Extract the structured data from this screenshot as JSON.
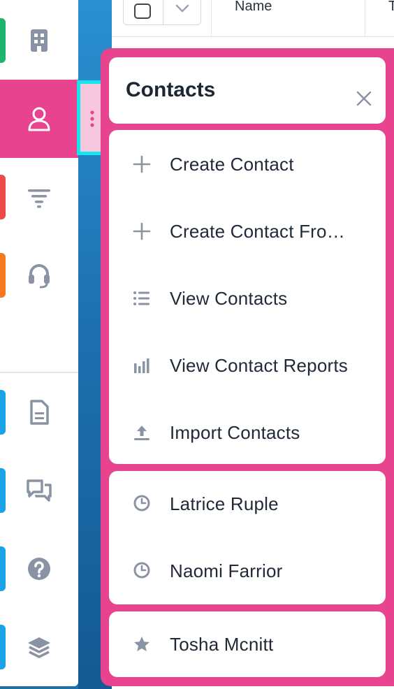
{
  "table": {
    "columns": [
      "Name",
      "T"
    ]
  },
  "sidebar": {
    "items": [
      {
        "name": "buildings",
        "icon": "building-icon",
        "accent": "#1fb36b"
      },
      {
        "name": "contacts",
        "icon": "person-icon",
        "accent": "#e8438f",
        "active": true
      },
      {
        "name": "pipeline",
        "icon": "filter-icon",
        "accent": "#ef4a4a"
      },
      {
        "name": "support",
        "icon": "headset-icon",
        "accent": "#f47a1f"
      },
      {
        "name": "documents",
        "icon": "document-icon",
        "accent": "#1aa3e8"
      },
      {
        "name": "chat",
        "icon": "chat-icon",
        "accent": "#1aa3e8"
      },
      {
        "name": "help",
        "icon": "help-icon",
        "accent": "#1aa3e8"
      },
      {
        "name": "layers",
        "icon": "layers-icon",
        "accent": "#1aa3e8"
      }
    ]
  },
  "flyout": {
    "title": "Contacts",
    "actions": [
      {
        "label": "Create Contact",
        "icon": "plus-icon"
      },
      {
        "label": "Create Contact Fro…",
        "icon": "plus-icon"
      },
      {
        "label": "View Contacts",
        "icon": "list-icon"
      },
      {
        "label": "View Contact Reports",
        "icon": "bar-chart-icon"
      },
      {
        "label": "Import Contacts",
        "icon": "upload-icon"
      }
    ],
    "recent": [
      {
        "label": "Latrice Ruple",
        "icon": "clock-icon"
      },
      {
        "label": "Naomi Farrior",
        "icon": "clock-icon"
      }
    ],
    "favorites": [
      {
        "label": "Tosha Mcnitt",
        "icon": "star-icon"
      }
    ]
  },
  "colors": {
    "accent": "#e8438f",
    "highlight": "#12e6ee",
    "icon_gray": "#8a93a3"
  }
}
